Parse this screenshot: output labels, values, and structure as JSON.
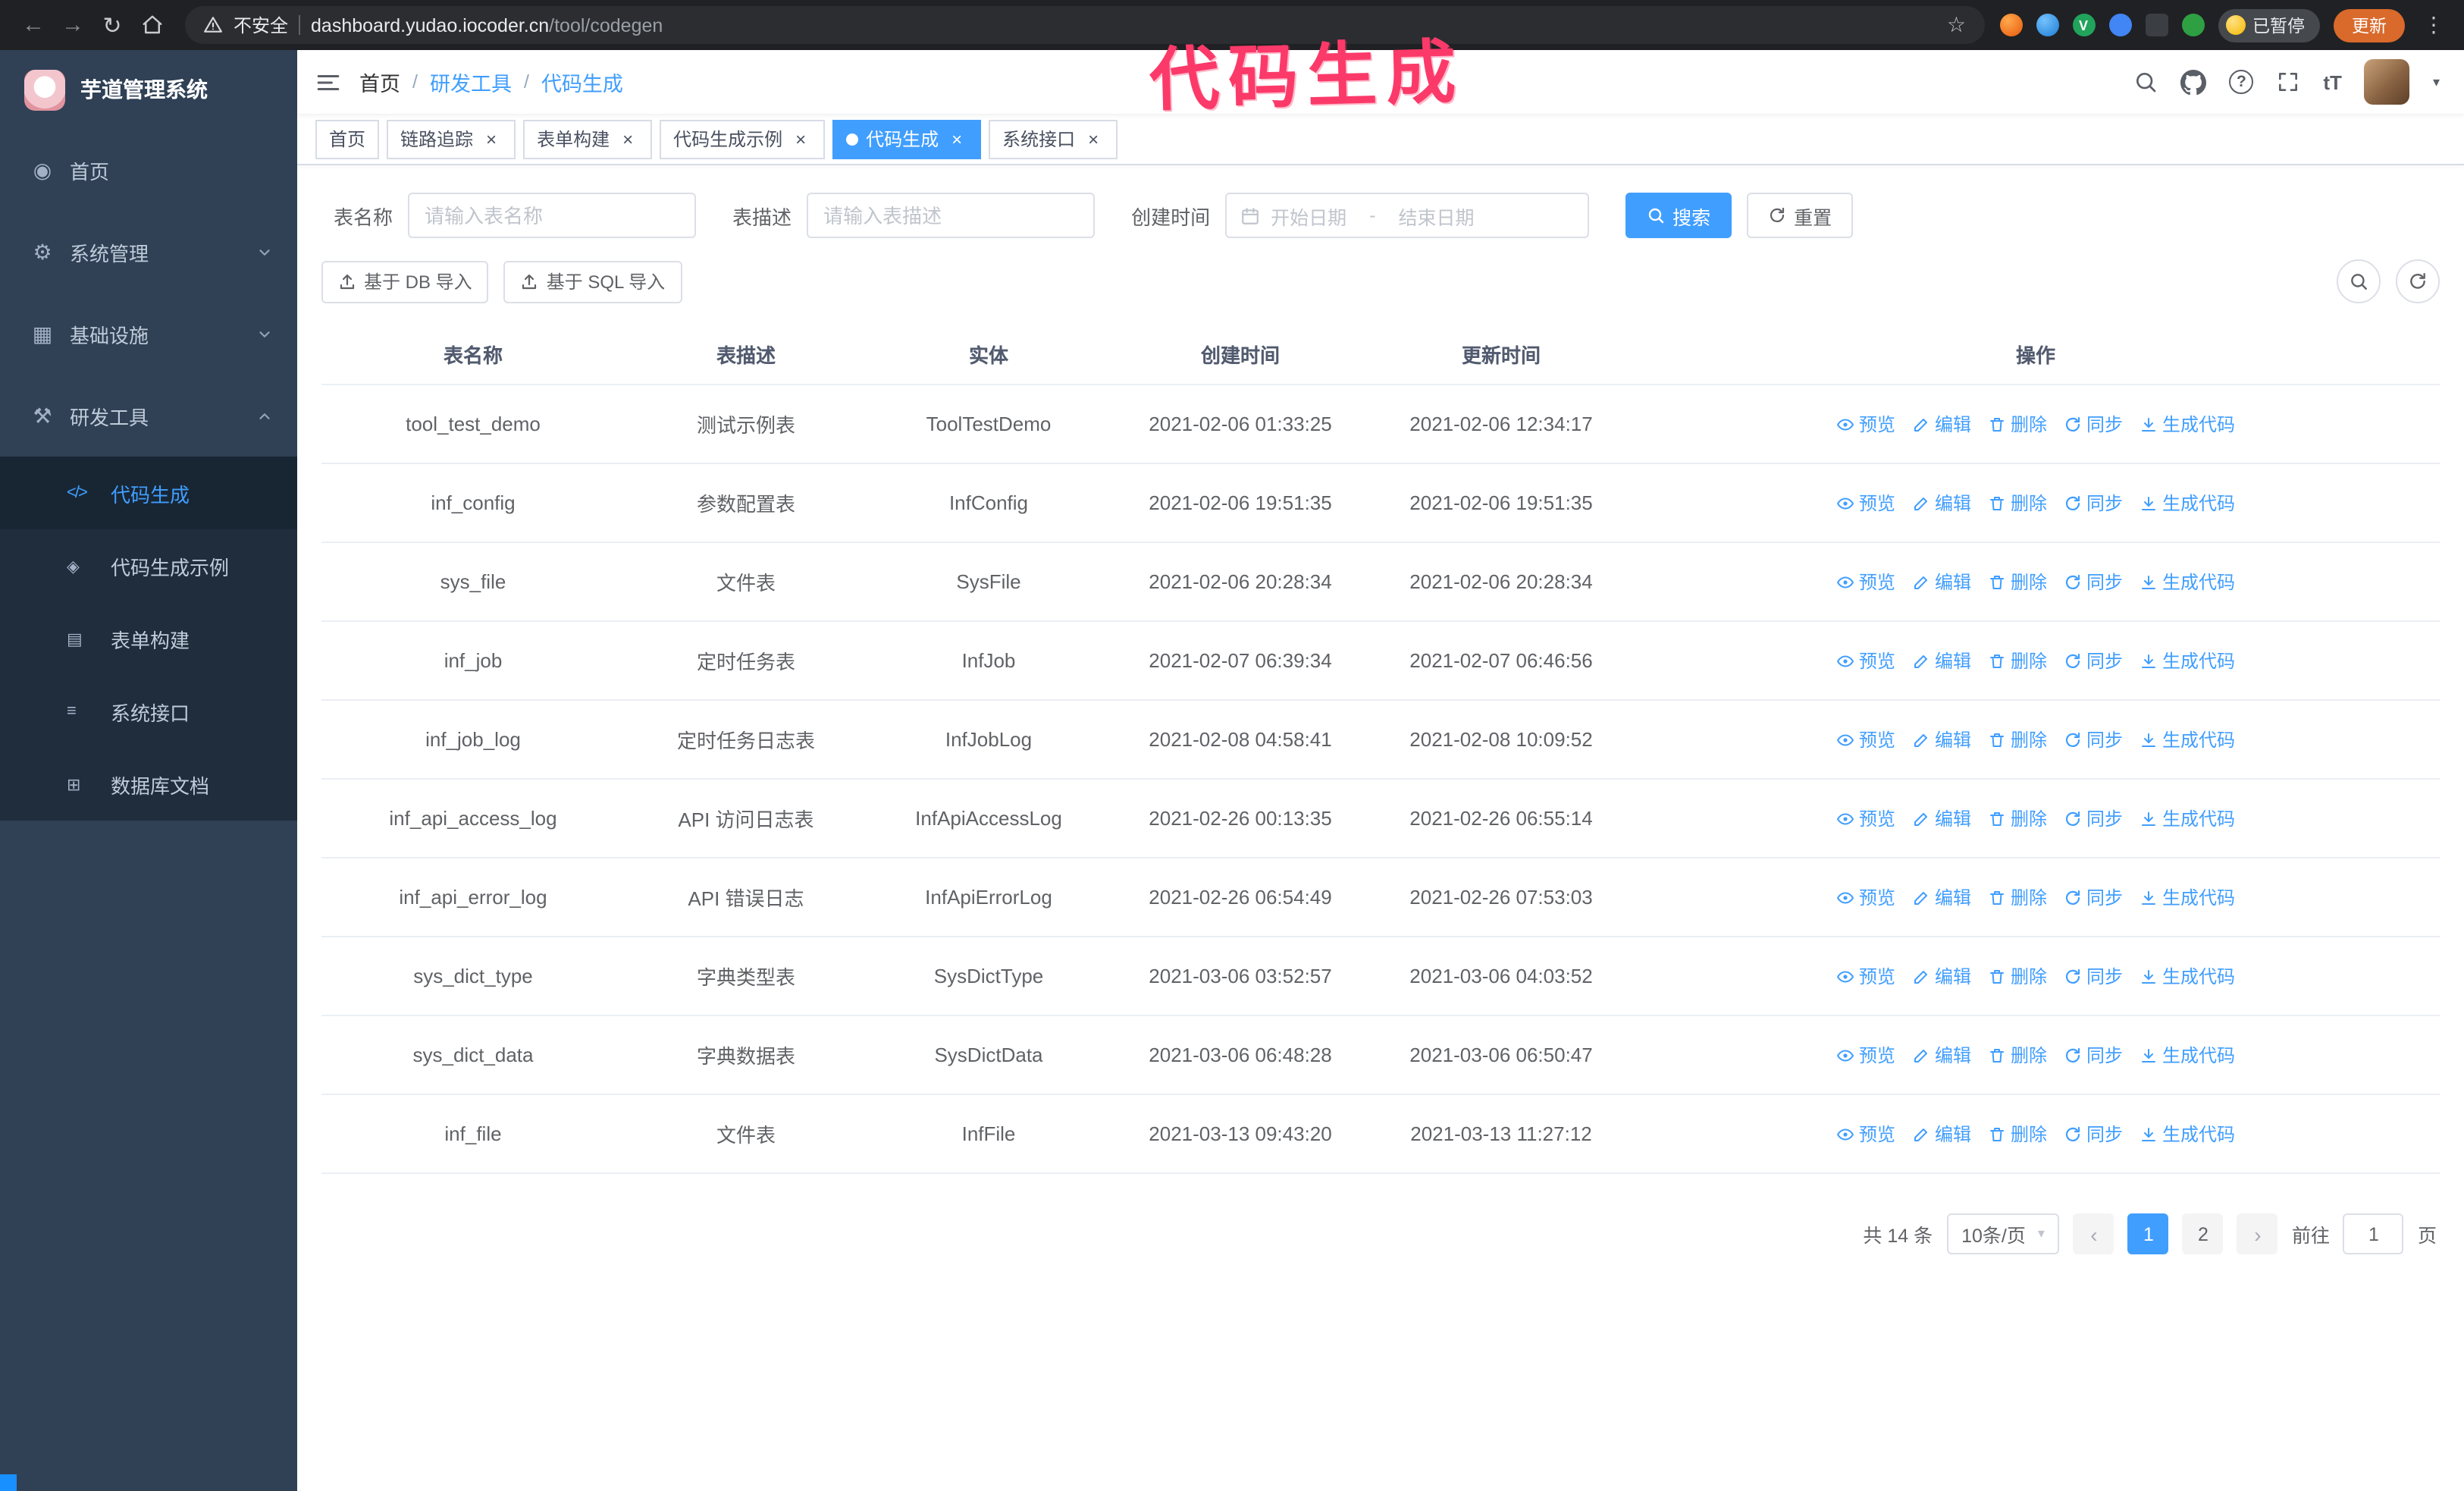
{
  "annotation": {
    "text": "代码生成"
  },
  "colors": {
    "accent": "#409eff",
    "annotation": "#fb3a69",
    "update_button": "#d96a2b",
    "sidebar_bg": "#304156",
    "submenu_bg": "#1f2d3d"
  },
  "icons": {
    "back": "←",
    "forward": "→",
    "reload": "↻",
    "star": "☆",
    "kebab": "⋮",
    "close": "×",
    "prev": "‹",
    "next": "›",
    "caret_down": "▾",
    "help": "?",
    "font_size": "tT"
  },
  "icon_glyphs": {
    "dashboard-icon": "◉",
    "gear-icon": "⚙",
    "infrastructure-icon": "▦",
    "dev-tools-icon": "⚒",
    "code-icon": "</>",
    "code-example-icon": "◈",
    "form-builder-icon": "▤",
    "api-icon": "≡",
    "database-icon": "⊞"
  },
  "browser": {
    "security_label": "不安全",
    "url_domain": "dashboard.yudao.iocoder.cn",
    "url_path": "/tool/codegen",
    "paused_badge": "已暂停",
    "update_button": "更新"
  },
  "sidebar": {
    "app_title": "芋道管理系统",
    "menu": [
      {
        "label": "首页",
        "icon": "dashboard-icon"
      },
      {
        "label": "系统管理",
        "icon": "gear-icon",
        "arrow_down": true
      },
      {
        "label": "基础设施",
        "icon": "infrastructure-icon",
        "arrow_down": true
      },
      {
        "label": "研发工具",
        "icon": "dev-tools-icon",
        "arrow_up": true,
        "open": true
      }
    ],
    "submenu": [
      {
        "label": "代码生成",
        "icon": "code-icon",
        "active": true
      },
      {
        "label": "代码生成示例",
        "icon": "code-example-icon"
      },
      {
        "label": "表单构建",
        "icon": "form-builder-icon"
      },
      {
        "label": "系统接口",
        "icon": "api-icon"
      },
      {
        "label": "数据库文档",
        "icon": "database-icon"
      }
    ]
  },
  "breadcrumb": {
    "items": [
      "首页",
      "研发工具",
      "代码生成"
    ],
    "separator": "/"
  },
  "tabs": [
    {
      "label": "首页"
    },
    {
      "label": "链路追踪",
      "closable": true
    },
    {
      "label": "表单构建",
      "closable": true
    },
    {
      "label": "代码生成示例",
      "closable": true
    },
    {
      "label": "代码生成",
      "closable": true,
      "active": true
    },
    {
      "label": "系统接口",
      "closable": true
    }
  ],
  "filters": {
    "table_name_label": "表名称",
    "table_name_placeholder": "请输入表名称",
    "table_desc_label": "表描述",
    "table_desc_placeholder": "请输入表描述",
    "create_time_label": "创建时间",
    "date_start_placeholder": "开始日期",
    "date_separator": "-",
    "date_end_placeholder": "结束日期",
    "search_button": "搜索",
    "reset_button": "重置"
  },
  "toolbar": {
    "import_db_button": "基于 DB 导入",
    "import_sql_button": "基于 SQL 导入"
  },
  "table": {
    "columns": [
      "表名称",
      "表描述",
      "实体",
      "创建时间",
      "更新时间",
      "操作"
    ],
    "actions": [
      {
        "label": "预览",
        "icon": "eye-icon"
      },
      {
        "label": "编辑",
        "icon": "edit-icon"
      },
      {
        "label": "删除",
        "icon": "delete-icon"
      },
      {
        "label": "同步",
        "icon": "sync-icon"
      },
      {
        "label": "生成代码",
        "icon": "download-icon"
      }
    ],
    "rows": [
      {
        "name": "tool_test_demo",
        "desc": "测试示例表",
        "entity": "ToolTestDemo",
        "created": "2021-02-06 01:33:25",
        "updated": "2021-02-06 12:34:17"
      },
      {
        "name": "inf_config",
        "desc": "参数配置表",
        "entity": "InfConfig",
        "created": "2021-02-06 19:51:35",
        "updated": "2021-02-06 19:51:35"
      },
      {
        "name": "sys_file",
        "desc": "文件表",
        "entity": "SysFile",
        "created": "2021-02-06 20:28:34",
        "updated": "2021-02-06 20:28:34"
      },
      {
        "name": "inf_job",
        "desc": "定时任务表",
        "entity": "InfJob",
        "created": "2021-02-07 06:39:34",
        "updated": "2021-02-07 06:46:56"
      },
      {
        "name": "inf_job_log",
        "desc": "定时任务日志表",
        "entity": "InfJobLog",
        "created": "2021-02-08 04:58:41",
        "updated": "2021-02-08 10:09:52"
      },
      {
        "name": "inf_api_access_log",
        "desc": "API 访问日志表",
        "entity": "InfApiAccessLog",
        "created": "2021-02-26 00:13:35",
        "updated": "2021-02-26 06:55:14"
      },
      {
        "name": "inf_api_error_log",
        "desc": "API 错误日志",
        "entity": "InfApiErrorLog",
        "created": "2021-02-26 06:54:49",
        "updated": "2021-02-26 07:53:03"
      },
      {
        "name": "sys_dict_type",
        "desc": "字典类型表",
        "entity": "SysDictType",
        "created": "2021-03-06 03:52:57",
        "updated": "2021-03-06 04:03:52"
      },
      {
        "name": "sys_dict_data",
        "desc": "字典数据表",
        "entity": "SysDictData",
        "created": "2021-03-06 06:48:28",
        "updated": "2021-03-06 06:50:47"
      },
      {
        "name": "inf_file",
        "desc": "文件表",
        "entity": "InfFile",
        "created": "2021-03-13 09:43:20",
        "updated": "2021-03-13 11:27:12"
      }
    ]
  },
  "pagination": {
    "total_text": "共 14 条",
    "page_size": "10条/页",
    "pages": [
      "1",
      "2"
    ],
    "active_page": "1",
    "goto_label": "前往",
    "goto_value": "1",
    "goto_unit": "页"
  }
}
